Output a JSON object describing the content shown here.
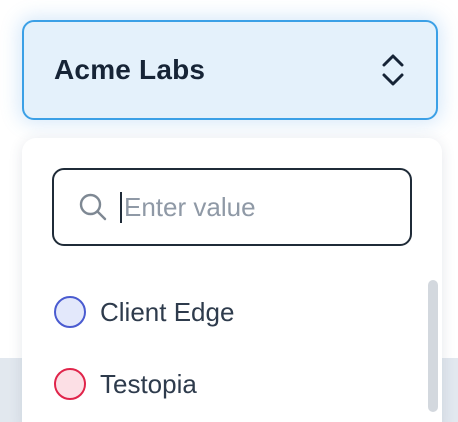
{
  "select": {
    "value": "Acme Labs",
    "icon": "chevron-up-down-icon"
  },
  "search": {
    "value": "",
    "placeholder": "Enter value",
    "icon": "search-icon"
  },
  "options": [
    {
      "label": "Client Edge",
      "color": "#4a5bd0",
      "fill": "#e3e8fb"
    },
    {
      "label": "Testopia",
      "color": "#e0244a",
      "fill": "#fcdfe5"
    }
  ],
  "colors": {
    "accent": "#3ba0e6",
    "trigger_background": "#e4f1fb",
    "text_dark": "#162436"
  }
}
